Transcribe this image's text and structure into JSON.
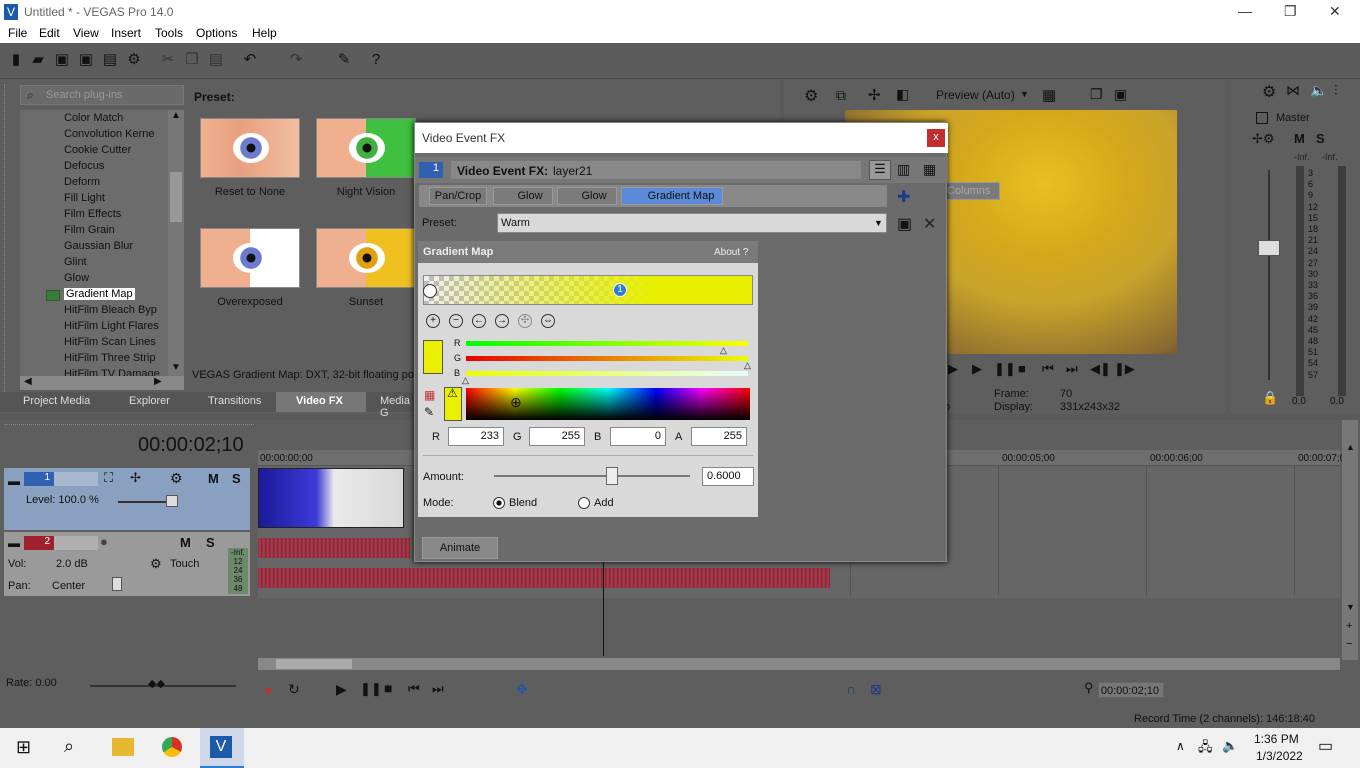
{
  "window": {
    "title": "Untitled * - VEGAS Pro 14.0"
  },
  "menu": [
    "File",
    "Edit",
    "View",
    "Insert",
    "Tools",
    "Options",
    "Help"
  ],
  "plugins": {
    "search_placeholder": "Search plug-ins",
    "items": [
      "Color Match",
      "Convolution Kerne",
      "Cookie Cutter",
      "Defocus",
      "Deform",
      "Fill Light",
      "Film Effects",
      "Film Grain",
      "Gaussian Blur",
      "Glint",
      "Glow",
      "Gradient Map",
      "HitFilm Bleach Byp",
      "HitFilm Light Flares",
      "HitFilm Scan Lines",
      "HitFilm Three Strip",
      "HitFilm TV Damage"
    ],
    "selected": "Gradient Map"
  },
  "presets": {
    "label": "Preset:",
    "thumbs": [
      "Reset to None",
      "Night Vision",
      "Overexposed",
      "Sunset"
    ],
    "description": "VEGAS Gradient Map: DXT, 32-bit floating poir"
  },
  "tabs": [
    "Project Media",
    "Explorer",
    "Transitions",
    "Video FX",
    "Media G"
  ],
  "preview": {
    "mode": "Preview (Auto)",
    "frame_label": "Frame:",
    "frame": "70",
    "display_label": "Display:",
    "display": "331x243x32",
    "p_suffix": "p"
  },
  "master": {
    "label": "Master",
    "inf_left": "-Inf.",
    "inf_right": "-Inf.",
    "scale": [
      "3",
      "6",
      "9",
      "12",
      "15",
      "18",
      "21",
      "24",
      "27",
      "30",
      "33",
      "36",
      "39",
      "42",
      "45",
      "48",
      "51",
      "54",
      "57"
    ],
    "bottom_left": "0.0",
    "bottom_right": "0.0"
  },
  "tooltip": "Columns",
  "timeline": {
    "timecode": "00:00:02;10",
    "ruler": [
      "00:00:00;00",
      "00:00:05;00",
      "00:00:06;00",
      "00:00:07;0"
    ],
    "track1": {
      "num": "1",
      "level": "Level: 100.0 %",
      "m": "M",
      "s": "S"
    },
    "track2": {
      "num": "2",
      "vol_label": "Vol:",
      "vol": "2.0 dB",
      "pan_label": "Pan:",
      "pan": "Center",
      "touch": "Touch",
      "m": "M",
      "s": "S",
      "meter": [
        "-Inf.",
        "12",
        "24",
        "36",
        "48"
      ]
    },
    "rate": "Rate: 0.00",
    "cursor_time": "00:00:02;10"
  },
  "status": {
    "record": "Record Time (2 channels): 146:18:40"
  },
  "fx": {
    "title": "Video Event FX",
    "close": "x",
    "chain_num": "1",
    "header_label": "Video Event FX:",
    "header_value": "layer21",
    "chain": [
      "Pan/Crop",
      "Glow",
      "Glow",
      "Gradient Map"
    ],
    "preset_label": "Preset:",
    "preset_value": "Warm",
    "gm": {
      "title": "Gradient Map",
      "about": "About  ?",
      "marker": "1",
      "r_label": "R",
      "g_label": "G",
      "b_label": "B",
      "a_label": "A",
      "r": "233",
      "g": "255",
      "b": "0",
      "a": "255",
      "amount_label": "Amount:",
      "amount": "0.6000",
      "mode_label": "Mode:",
      "blend": "Blend",
      "add": "Add"
    },
    "animate": "Animate"
  },
  "taskbar": {
    "time": "1:36 PM",
    "date": "1/3/2022"
  },
  "colors": {
    "accent": "#2e7fd1",
    "gradient_end": "#e8f000"
  }
}
